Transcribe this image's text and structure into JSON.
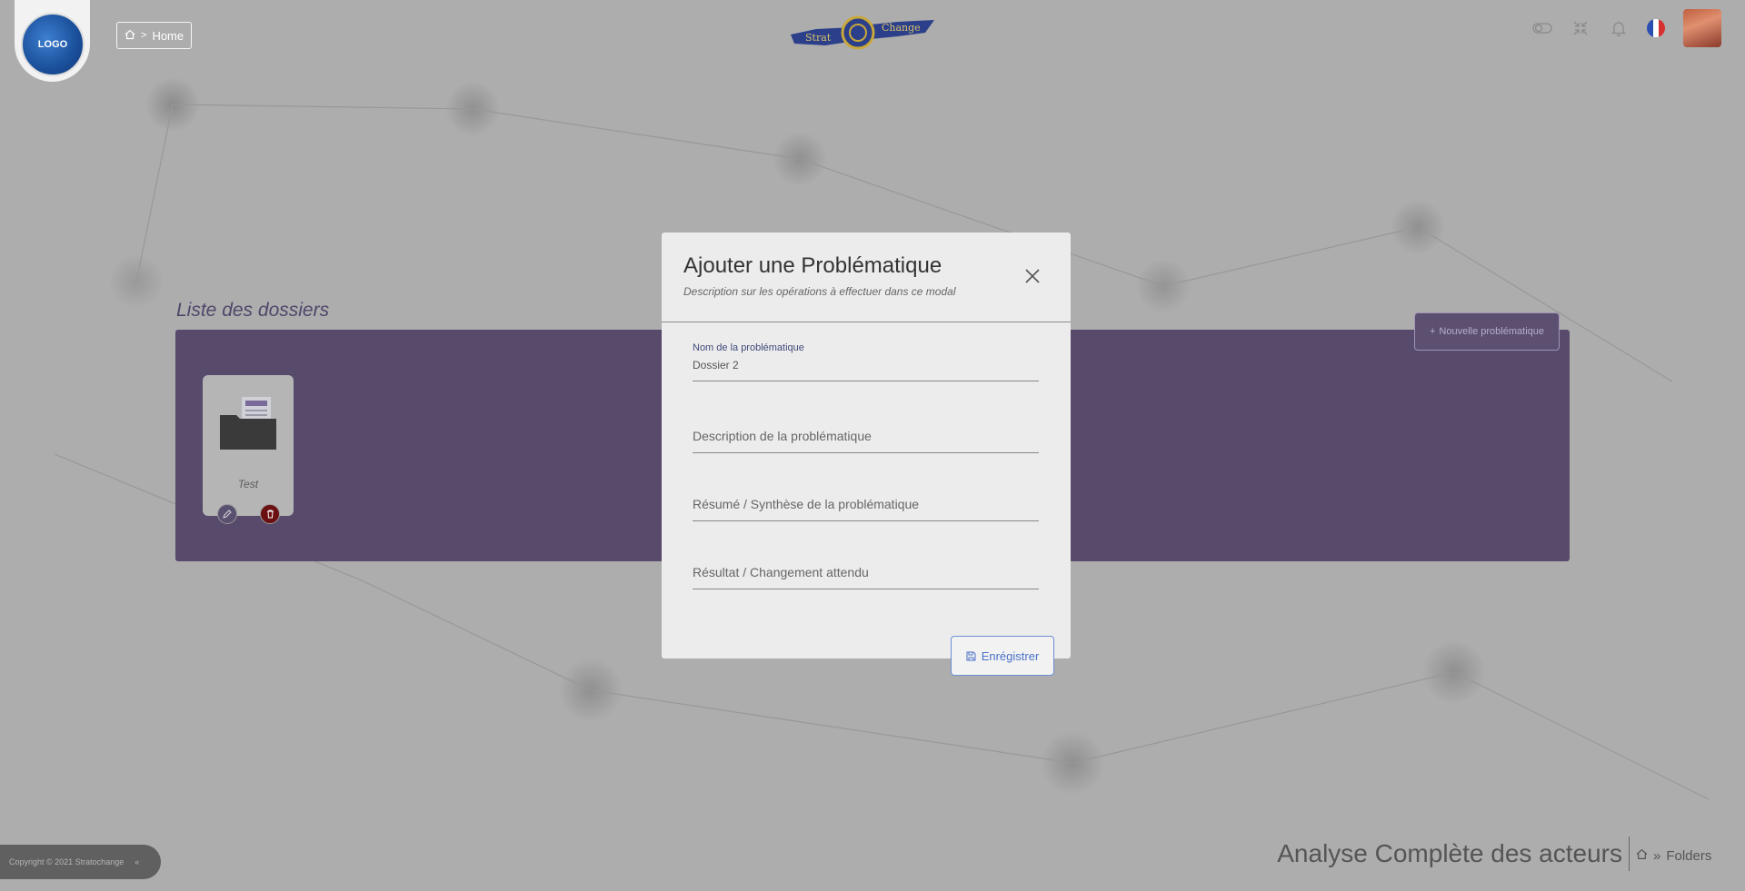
{
  "header": {
    "logo_text": "LOGO",
    "breadcrumb": {
      "home_label": "Home"
    },
    "brand": {
      "word1": "Strat",
      "word2": "Change"
    },
    "icons": [
      "toggle-icon",
      "compress-icon",
      "bell-icon",
      "france-flag-icon",
      "user-avatar"
    ]
  },
  "main": {
    "list_title": "Liste des dossiers",
    "new_button_label": "Nouvelle problématique",
    "folders": [
      {
        "name": "Test"
      }
    ]
  },
  "modal": {
    "title": "Ajouter une Problématique",
    "subtitle": "Description sur les opérations à effectuer dans ce modal",
    "fields": [
      {
        "label": "Nom de la problématique",
        "value": "Dossier 2"
      },
      {
        "placeholder": "Description de la problématique"
      },
      {
        "placeholder": "Résumé / Synthèse de la problématique"
      },
      {
        "placeholder": "Résultat / Changement attendu"
      }
    ],
    "save_label": "Enrégistrer"
  },
  "footer": {
    "copyright": "Copyright © 2021 Stratochange",
    "collapse_symbol": "«",
    "page_heading": "Analyse Complète des acteurs",
    "crumb_sep": "»",
    "crumb_label": "Folders"
  },
  "colors": {
    "panel": "#574a6b",
    "accent_blue": "#4a72c8",
    "delete_red": "#6a1010"
  }
}
